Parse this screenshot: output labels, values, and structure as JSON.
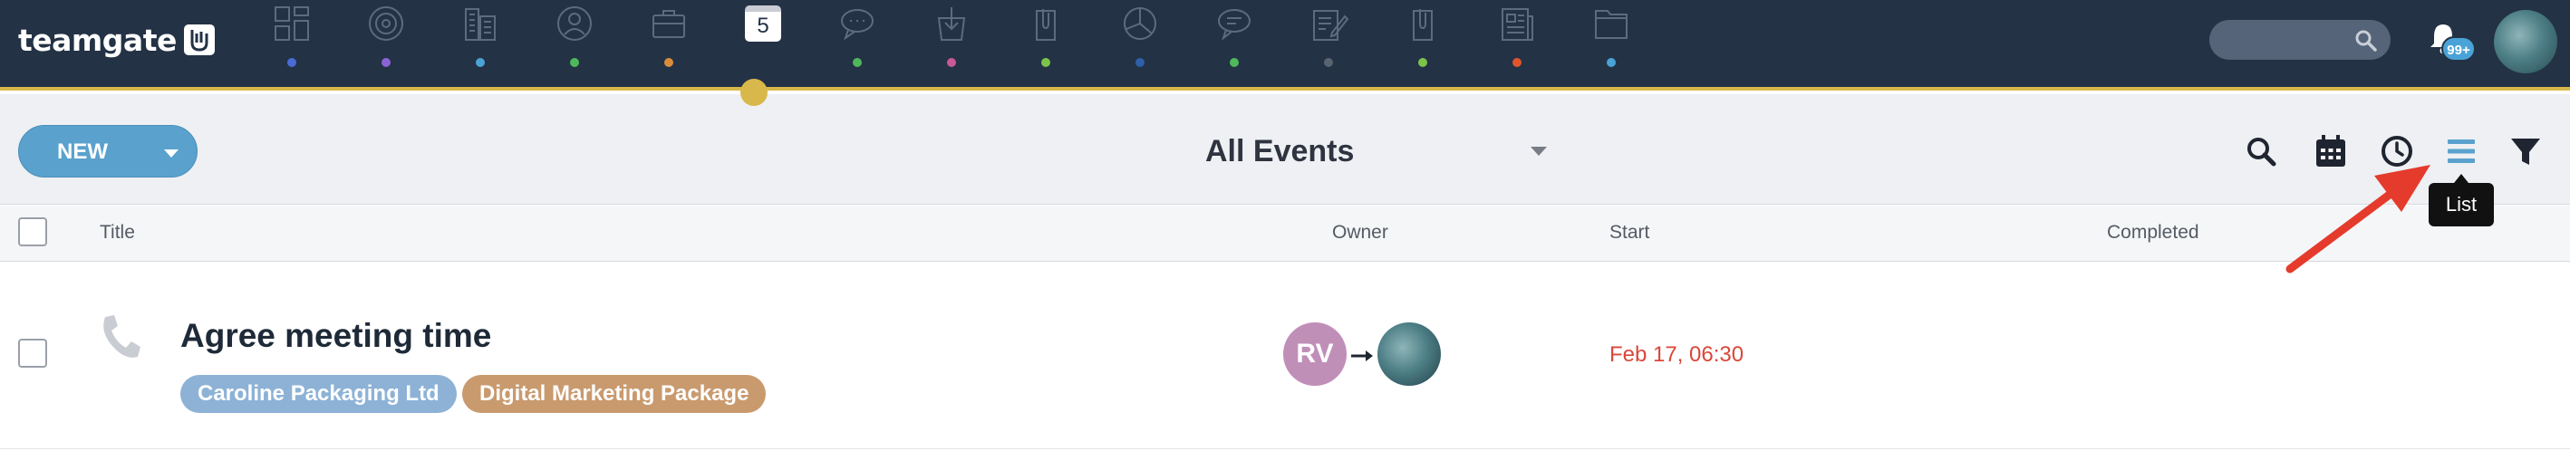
{
  "app": {
    "logo_text": "teamgate"
  },
  "nav": {
    "items": [
      {
        "icon": "dashboard-icon",
        "dot_color": "#4a6bd6"
      },
      {
        "icon": "target-icon",
        "dot_color": "#8a64d6"
      },
      {
        "icon": "buildings-icon",
        "dot_color": "#4aa3d6"
      },
      {
        "icon": "person-icon",
        "dot_color": "#4fb85a"
      },
      {
        "icon": "briefcase-icon",
        "dot_color": "#d98c3c"
      },
      {
        "icon": "calendar-icon",
        "label": "5",
        "dot_color": "#233245"
      },
      {
        "icon": "chat-icon",
        "dot_color": "#4fb85a"
      },
      {
        "icon": "download-bag-icon",
        "dot_color": "#c9589a"
      },
      {
        "icon": "clip-icon",
        "dot_color": "#7cc44a"
      },
      {
        "icon": "pie-chart-icon",
        "dot_color": "#2f5fa8"
      },
      {
        "icon": "comments-icon",
        "dot_color": "#4fb85a"
      },
      {
        "icon": "note-edit-icon",
        "dot_color": "#5a6470"
      },
      {
        "icon": "attachment-icon",
        "dot_color": "#7cc44a"
      },
      {
        "icon": "newspaper-icon",
        "dot_color": "#e0552e"
      },
      {
        "icon": "folder-icon",
        "dot_color": "#4aa3d6"
      }
    ],
    "active_index": 5
  },
  "header": {
    "search_icon": "search-icon",
    "notifications_badge": "99+",
    "avatar_icon": "user-avatar"
  },
  "toolbar": {
    "new_label": "NEW",
    "view_title": "All Events",
    "tools": [
      "search-icon",
      "calendar-icon",
      "clock-icon",
      "list-icon",
      "filter-icon"
    ],
    "tooltip": "List"
  },
  "table": {
    "columns": {
      "title": "Title",
      "owner": "Owner",
      "start": "Start",
      "completed": "Completed"
    },
    "rows": [
      {
        "icon": "phone-icon",
        "title": "Agree meeting time",
        "company_tag": "Caroline Packaging Ltd",
        "product_tag": "Digital Marketing Package",
        "owner_initials": "RV",
        "start": "Feb 17, 06:30",
        "completed": ""
      }
    ]
  },
  "colors": {
    "nav_bg": "#233245",
    "accent": "#d8b84a",
    "primary_button": "#5aa2cd",
    "start_date": "#d9473a"
  }
}
